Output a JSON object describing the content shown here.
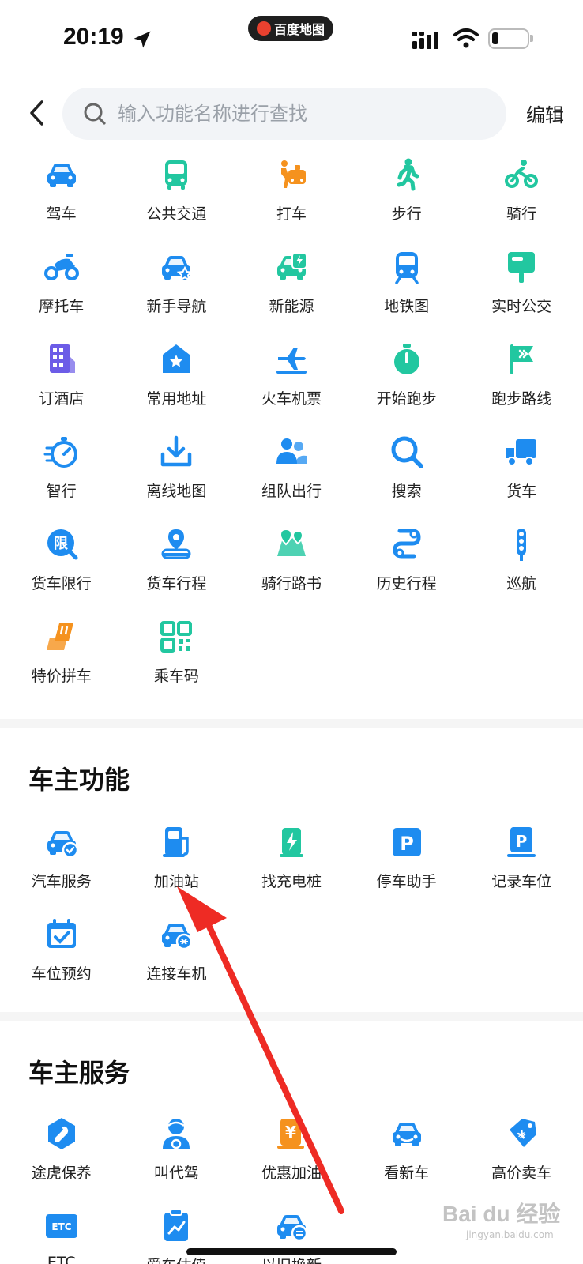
{
  "status": {
    "time": "20:19",
    "app_badge": "百度地图"
  },
  "header": {
    "search_placeholder": "输入功能名称进行查找",
    "edit_label": "编辑"
  },
  "colors": {
    "blue": "#1e8cf0",
    "green": "#22c7a0",
    "orange": "#f5921e",
    "purple": "#6c5ce7"
  },
  "main_grid": [
    {
      "label": "驾车",
      "icon": "car-icon"
    },
    {
      "label": "公共交通",
      "icon": "bus-icon"
    },
    {
      "label": "打车",
      "icon": "taxi-icon"
    },
    {
      "label": "步行",
      "icon": "walk-icon"
    },
    {
      "label": "骑行",
      "icon": "bike-icon"
    },
    {
      "label": "摩托车",
      "icon": "motorcycle-icon"
    },
    {
      "label": "新手导航",
      "icon": "star-car-icon"
    },
    {
      "label": "新能源",
      "icon": "ev-car-icon"
    },
    {
      "label": "地铁图",
      "icon": "subway-icon"
    },
    {
      "label": "实时公交",
      "icon": "bus-stop-icon"
    },
    {
      "label": "订酒店",
      "icon": "hotel-icon"
    },
    {
      "label": "常用地址",
      "icon": "home-star-icon"
    },
    {
      "label": "火车机票",
      "icon": "plane-train-icon"
    },
    {
      "label": "开始跑步",
      "icon": "stopwatch-icon"
    },
    {
      "label": "跑步路线",
      "icon": "flag-icon"
    },
    {
      "label": "智行",
      "icon": "speed-icon"
    },
    {
      "label": "离线地图",
      "icon": "download-icon"
    },
    {
      "label": "组队出行",
      "icon": "team-icon"
    },
    {
      "label": "搜索",
      "icon": "search-icon"
    },
    {
      "label": "货车",
      "icon": "truck-icon"
    },
    {
      "label": "货车限行",
      "icon": "restrict-icon",
      "badge": "限"
    },
    {
      "label": "货车行程",
      "icon": "route-pin-icon"
    },
    {
      "label": "骑行路书",
      "icon": "map-pin-icon"
    },
    {
      "label": "历史行程",
      "icon": "history-route-icon"
    },
    {
      "label": "巡航",
      "icon": "traffic-light-icon"
    },
    {
      "label": "特价拼车",
      "icon": "seat-icon"
    },
    {
      "label": "乘车码",
      "icon": "qr-code-icon"
    }
  ],
  "owner_functions": {
    "title": "车主功能",
    "items": [
      {
        "label": "汽车服务",
        "icon": "car-check-icon"
      },
      {
        "label": "加油站",
        "icon": "fuel-icon"
      },
      {
        "label": "找充电桩",
        "icon": "charger-icon"
      },
      {
        "label": "停车助手",
        "icon": "parking-icon",
        "badge": "P"
      },
      {
        "label": "记录车位",
        "icon": "parking-record-icon",
        "badge": "P"
      },
      {
        "label": "车位预约",
        "icon": "calendar-check-icon"
      },
      {
        "label": "连接车机",
        "icon": "car-link-icon"
      }
    ]
  },
  "owner_services": {
    "title": "车主服务",
    "items": [
      {
        "label": "途虎保养",
        "icon": "wrench-icon"
      },
      {
        "label": "叫代驾",
        "icon": "driver-icon"
      },
      {
        "label": "优惠加油",
        "icon": "fuel-discount-icon",
        "badge": "¥"
      },
      {
        "label": "看新车",
        "icon": "new-car-icon"
      },
      {
        "label": "高价卖车",
        "icon": "price-tag-icon"
      },
      {
        "label": "ETC",
        "icon": "etc-icon",
        "badge": "ETC"
      },
      {
        "label": "爱车估值",
        "icon": "valuation-icon"
      },
      {
        "label": "以旧换新",
        "icon": "trade-in-icon"
      }
    ]
  },
  "watermark": {
    "text": "Bai du 经验",
    "sub": "jingyan.baidu.com"
  }
}
